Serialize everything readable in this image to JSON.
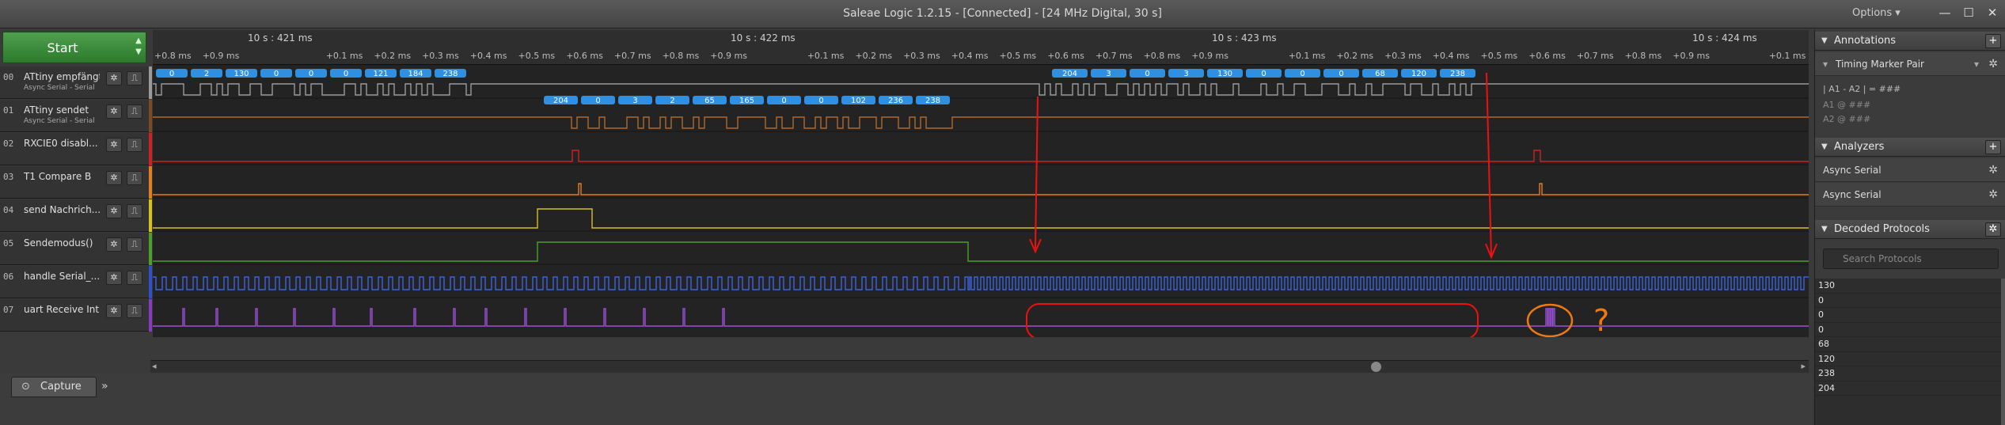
{
  "window": {
    "title": "Saleae Logic 1.2.15 - [Connected] - [24 MHz Digital, 30 s]",
    "options_label": "Options ▾",
    "minimize_label": "—",
    "maximize_label": "☐",
    "close_label": "✕"
  },
  "start": {
    "label": "Start",
    "arrows_up": "▲",
    "arrows_down": "▼"
  },
  "channels": [
    {
      "num": "00",
      "name": "ATtiny empfängt",
      "sub": "Async Serial - Serial",
      "color": "#9a9a9a"
    },
    {
      "num": "01",
      "name": "ATtiny sendet",
      "sub": "Async Serial - Serial",
      "color": "#7a4a22"
    },
    {
      "num": "02",
      "name": "RXCIE0 disabl...",
      "sub": "",
      "color": "#cc2222"
    },
    {
      "num": "03",
      "name": "T1 Compare B",
      "sub": "",
      "color": "#e08020"
    },
    {
      "num": "04",
      "name": "send Nachrich...",
      "sub": "",
      "color": "#d8c020"
    },
    {
      "num": "05",
      "name": "Sendemodus()",
      "sub": "",
      "color": "#4aa02a"
    },
    {
      "num": "06",
      "name": "handle Serial_...",
      "sub": "",
      "color": "#3050c8"
    },
    {
      "num": "07",
      "name": "uart Receive Int",
      "sub": "",
      "color": "#8a3ac0"
    }
  ],
  "channel_buttons": {
    "gear": "✲",
    "trigger": "⎍"
  },
  "timeline": {
    "major": [
      "10 s : 421 ms",
      "10 s : 422 ms",
      "10 s : 423 ms",
      "10 s : 424 ms"
    ],
    "minor_seq": [
      "+0.1 ms",
      "+0.2 ms",
      "+0.3 ms",
      "+0.4 ms",
      "+0.5 ms",
      "+0.6 ms",
      "+0.7 ms",
      "+0.8 ms",
      "+0.9 ms"
    ],
    "minor_lead": [
      "+0.8 ms",
      "+0.9 ms"
    ]
  },
  "decoded": {
    "ch00_a": [
      "0",
      "2",
      "130",
      "0",
      "0",
      "0",
      "121",
      "184",
      "238"
    ],
    "ch01": [
      "204",
      "0",
      "3",
      "2",
      "65",
      "165",
      "0",
      "0",
      "102",
      "236",
      "238"
    ],
    "ch00_b": [
      "204",
      "3",
      "0",
      "3",
      "130",
      "0",
      "0",
      "0",
      "68",
      "120",
      "238"
    ]
  },
  "bottom": {
    "capture_label": "Capture",
    "more_label": "»"
  },
  "sidebar": {
    "annotations": {
      "title": "Annotations",
      "add": "+",
      "marker_pair": "Timing Marker Pair",
      "formula": "| A1 - A2 | = ###",
      "a1": "A1  @  ###",
      "a2": "A2  @  ###"
    },
    "analyzers": {
      "title": "Analyzers",
      "add": "+",
      "items": [
        "Async Serial",
        "Async Serial"
      ]
    },
    "decoded_protocols": {
      "title": "Decoded Protocols",
      "search_placeholder": "Search Protocols",
      "rows": [
        "130",
        "0",
        "0",
        "0",
        "68",
        "120",
        "238",
        "204"
      ]
    }
  },
  "annotations_overlay": {
    "question_mark": "?"
  },
  "colors": {
    "marker_red": "#ee1111",
    "circle_orange": "#f07a10",
    "decode_bubble": "#2f8fe0",
    "ch06_blue": "#3b64d8",
    "ch07_purple": "#9b4fd6"
  }
}
